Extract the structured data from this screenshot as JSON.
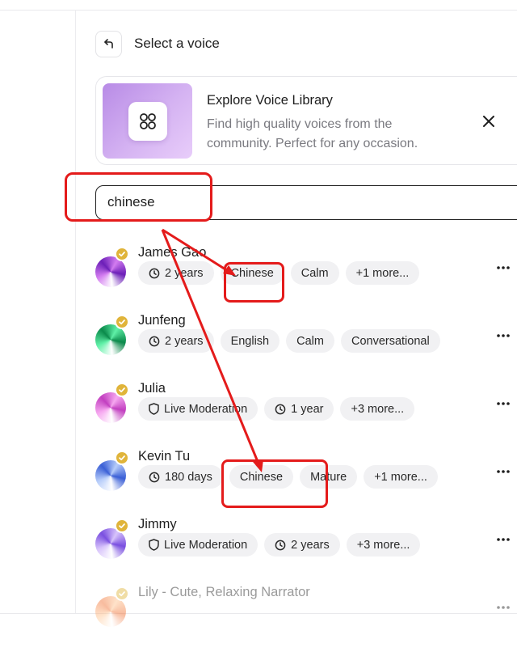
{
  "header": {
    "title": "Select a voice",
    "back_icon": "back-arrow-icon"
  },
  "library_card": {
    "title": "Explore Voice Library",
    "description": "Find high quality voices from the community. Perfect for any occasion.",
    "icon": "voice-library-icon",
    "close_icon": "close-icon"
  },
  "search": {
    "value": "chinese"
  },
  "voices": [
    {
      "name": "James Gao",
      "avatar_colors": [
        "#d37cf0",
        "#6c1fb8"
      ],
      "tags": [
        {
          "label": "2 years",
          "icon": "clock"
        },
        {
          "label": "Chinese"
        },
        {
          "label": "Calm"
        },
        {
          "label": "+1 more..."
        }
      ]
    },
    {
      "name": "Junfeng",
      "avatar_colors": [
        "#5ff0a7",
        "#0b8a4b"
      ],
      "tags": [
        {
          "label": "2 years",
          "icon": "clock"
        },
        {
          "label": "English"
        },
        {
          "label": "Calm"
        },
        {
          "label": "Conversational"
        }
      ]
    },
    {
      "name": "Julia",
      "avatar_colors": [
        "#f6a8f0",
        "#c23fc0"
      ],
      "tags": [
        {
          "label": "Live Moderation",
          "icon": "shield"
        },
        {
          "label": "1 year",
          "icon": "clock"
        },
        {
          "label": "+3 more..."
        }
      ]
    },
    {
      "name": "Kevin Tu",
      "avatar_colors": [
        "#b7cdfa",
        "#3a5fd6"
      ],
      "tags": [
        {
          "label": "180 days",
          "icon": "clock"
        },
        {
          "label": "Chinese"
        },
        {
          "label": "Mature"
        },
        {
          "label": "+1 more..."
        }
      ]
    },
    {
      "name": "Jimmy",
      "avatar_colors": [
        "#d8c4fb",
        "#7a4fe0"
      ],
      "tags": [
        {
          "label": "Live Moderation",
          "icon": "shield"
        },
        {
          "label": "2 years",
          "icon": "clock"
        },
        {
          "label": "+3 more..."
        }
      ]
    },
    {
      "name": "Lily - Cute, Relaxing Narrator",
      "avatar_colors": [
        "#ffc18a",
        "#f06a2a"
      ],
      "tags": []
    }
  ],
  "more_icon": "more-horizontal-icon",
  "colors": {
    "annotation": "#e41b1b",
    "badge": "#e0b43a",
    "tag_bg": "#f1f1f3"
  }
}
